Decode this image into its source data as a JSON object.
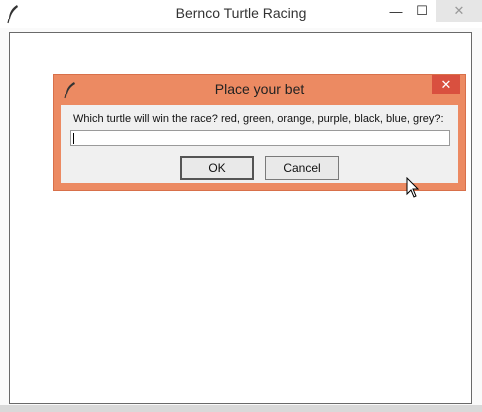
{
  "main_window": {
    "title": "Bernco Turtle Racing",
    "icon": "feather-icon",
    "controls": {
      "minimize": "minimize-icon",
      "maximize": "maximize-icon",
      "close": "close-icon"
    }
  },
  "dialog": {
    "title": "Place your bet",
    "icon": "feather-icon",
    "close_icon": "close-icon",
    "close_glyph": "✕",
    "prompt": "Which turtle will win the race? red, green, orange, purple, black, blue, grey?:",
    "input_value": "",
    "ok_label": "OK",
    "cancel_label": "Cancel",
    "accent_color": "#ec8a62",
    "close_color": "#d9503f"
  },
  "glyphs": {
    "minimize": "—",
    "maximize": "☐",
    "close": "✕"
  }
}
